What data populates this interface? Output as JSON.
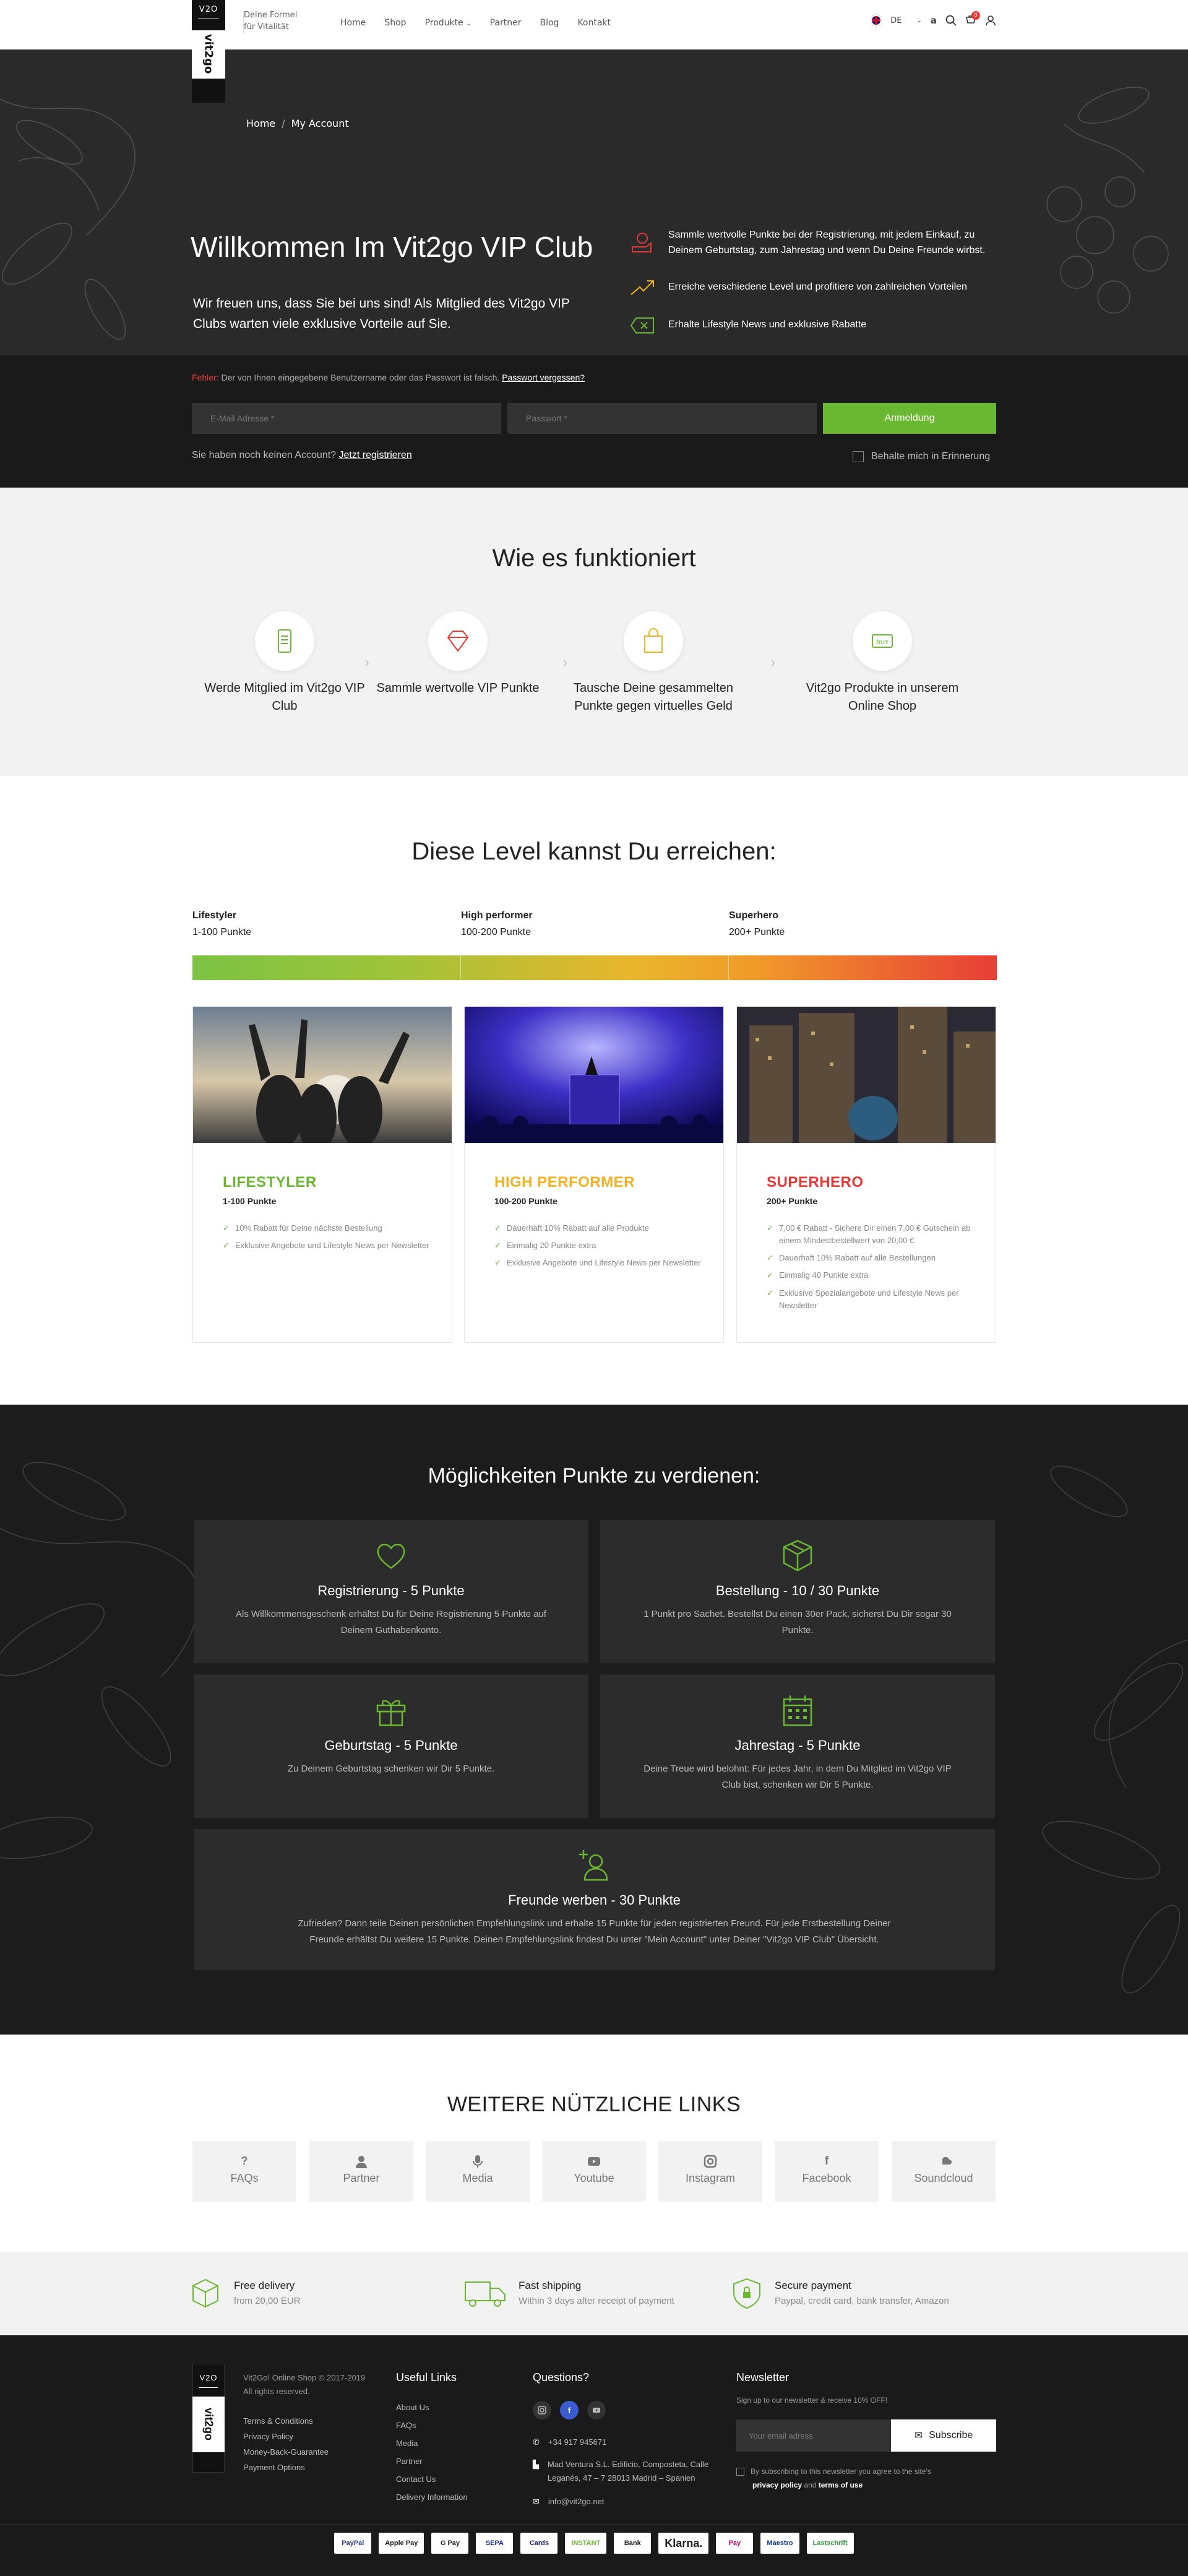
{
  "header": {
    "logo_top": "V2O",
    "logo_brand": "vit2go",
    "tagline_1": "Deine Formel",
    "tagline_2": "für Vitalität",
    "nav": [
      "Home",
      "Shop",
      "Produkte",
      "Partner",
      "Blog",
      "Kontakt"
    ],
    "lang": "DE",
    "cart_count": "0"
  },
  "hero": {
    "breadcrumb": [
      "Home",
      "My Account"
    ],
    "title": "Willkommen Im Vit2go VIP Club",
    "intro": "Wir freuen uns, dass Sie bei uns sind! Als Mitglied des Vit2go VIP Clubs warten viele exklusive Vorteile auf Sie.",
    "benefits": [
      "Sammle wertvolle Punkte bei der Registrierung, mit jedem Einkauf, zu Deinem Geburtstag, zum Jahrestag und wenn Du Deine Freunde wirbst.",
      "Erreiche verschiedene Level und profitiere von zahlreichen Vorteilen",
      "Erhalte Lifestyle News und exklusive Rabatte"
    ]
  },
  "login": {
    "error_label": "Fehler:",
    "error_text": "Der von Ihnen eingegebene Benutzername oder das Passwort ist falsch.",
    "forgot": "Passwort vergessen?",
    "email_placeholder": "E-Mail Adresse *",
    "password_placeholder": "Passwort *",
    "submit": "Anmeldung",
    "no_account": "Sie haben noch keinen Account?",
    "register": "Jetzt registrieren",
    "remember": "Behalte mich in Erinnerung"
  },
  "how": {
    "title": "Wie es funktioniert",
    "steps": [
      "Werde Mitglied im Vit2go VIP Club",
      "Sammle wertvolle VIP Punkte",
      "Tausche Deine gesammelten Punkte gegen virtuelles Geld",
      "Vit2go Produkte in unserem Online Shop"
    ]
  },
  "levels": {
    "title": "Diese Level kannst Du erreichen:",
    "headers": [
      {
        "name": "Lifestyler",
        "range": "1-100 Punkte"
      },
      {
        "name": "High performer",
        "range": "100-200 Punkte"
      },
      {
        "name": "Superhero",
        "range": "200+ Punkte"
      }
    ],
    "cards": [
      {
        "title": "LIFESTYLER",
        "points": "1-100 Punkte",
        "color": "#6ab731",
        "items": [
          "10% Rabatt für Deine nächste Bestellung",
          "Exklusive Angebote und Lifestyle News per Newsletter"
        ]
      },
      {
        "title": "HIGH PERFORMER",
        "points": "100-200 Punkte",
        "color": "#f0b323",
        "items": [
          "Dauerhaft 10% Rabatt auf alle Produkte",
          "Einmalig 20 Punkte extra",
          "Exklusive Angebote und Lifestyle News per Newsletter"
        ]
      },
      {
        "title": "SUPERHERO",
        "points": "200+ Punkte",
        "color": "#e53935",
        "items": [
          "7,00 € Rabatt - Sichere Dir einen 7,00 € Gutschein ab einem Mindestbestellwert von 20,00 €",
          "Dauerhaft 10% Rabatt auf alle Bestellungen",
          "Einmalig 40 Punkte extra",
          "Exklusive Spezialangebote und Lifestyle News per Newsletter"
        ]
      }
    ]
  },
  "earn": {
    "title": "Möglichkeiten Punkte zu verdienen:",
    "cards": [
      {
        "title": "Registrierung - 5 Punkte",
        "text": "Als Willkommensgeschenk erhältst Du für Deine Registrierung 5 Punkte auf Deinem Guthabenkonto."
      },
      {
        "title": "Bestellung - 10 / 30 Punkte",
        "text": "1 Punkt pro Sachet. Bestellst Du einen 30er Pack, sicherst Du Dir sogar 30 Punkte."
      },
      {
        "title": "Geburtstag - 5 Punkte",
        "text": "Zu Deinem Geburtstag schenken wir Dir 5 Punkte."
      },
      {
        "title": "Jahrestag - 5 Punkte",
        "text": "Deine Treue wird belohnt: Für jedes Jahr, in dem Du Mitglied im Vit2go VIP Club bist, schenken wir Dir 5 Punkte."
      },
      {
        "title": "Freunde werben - 30 Punkte",
        "text": "Zufrieden? Dann teile Deinen persönlichen Empfehlungslink und erhalte 15 Punkte für jeden registrierten Freund. Für jede Erstbestellung Deiner Freunde erhältst Du weitere 15 Punkte. Deinen Empfehlungslink findest Du unter \"Mein Account\" unter Deiner \"Vit2go VIP Club\" Übersicht."
      }
    ]
  },
  "links": {
    "title": "WEITERE NÜTZLICHE LINKS",
    "items": [
      "FAQs",
      "Partner",
      "Media",
      "Youtube",
      "Instagram",
      "Facebook",
      "Soundcloud"
    ]
  },
  "features": [
    {
      "title": "Free delivery",
      "text": "from 20,00 EUR"
    },
    {
      "title": "Fast shipping",
      "text": "Within 3 days after receipt of payment"
    },
    {
      "title": "Secure payment",
      "text": "Paypal, credit card, bank transfer, Amazon"
    }
  ],
  "footer": {
    "copyright_1": "Vit2Go! Online Shop © 2017-2019",
    "copyright_2": "All rights reserved.",
    "legal": [
      "Terms & Conditions",
      "Privacy Policy",
      "Money-Back-Guarantee",
      "Payment Options"
    ],
    "useful_title": "Useful Links",
    "useful": [
      "About Us",
      "FAQs",
      "Media",
      "Partner",
      "Contact Us",
      "Delivery Information"
    ],
    "questions_title": "Questions?",
    "phone": "+34 917 945671",
    "address": "Mad Ventura S.L. Edificio, Composteta, Calle Leganés, 47 – 7 28013 Madrid – Spanien",
    "email": "info@vit2go.net",
    "newsletter_title": "Newsletter",
    "newsletter_text": "Sign up to our newsletter & receive 10% OFF!",
    "email_placeholder": "Your email adress",
    "subscribe": "Subscribe",
    "consent_1": "By subscribing to this newsletter you agree to the site's",
    "consent_policy": "privacy policy",
    "consent_and": "and",
    "consent_terms": "terms of use",
    "payments": [
      "PayPal",
      "Apple Pay",
      "G Pay",
      "SEPA",
      "Cards",
      "INSTANT",
      "Bank",
      "Klarna.",
      "Pay",
      "Maestro",
      "Lastschrift"
    ]
  },
  "colors": {
    "green": "#6ab731",
    "orange": "#f0b323",
    "red": "#e53935",
    "dark": "#1c1c1c"
  }
}
